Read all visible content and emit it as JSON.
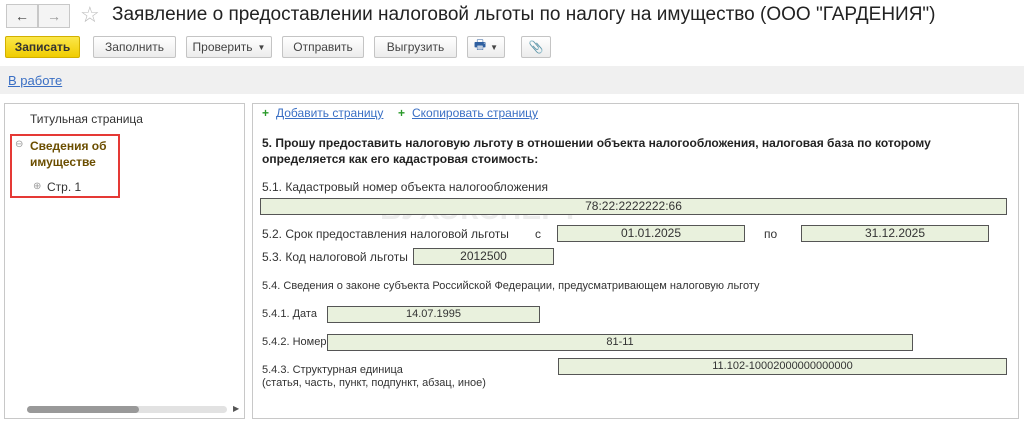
{
  "window": {
    "title": "Заявление о предоставлении налоговой льготы по налогу на имущество (ООО \"ГАРДЕНИЯ\")"
  },
  "toolbar": {
    "save": "Записать",
    "fill": "Заполнить",
    "check": "Проверить",
    "send": "Отправить",
    "export": "Выгрузить"
  },
  "status": {
    "link": "В работе"
  },
  "tree": {
    "items": [
      {
        "label": "Титульная страница"
      },
      {
        "label": "Сведения об имуществе"
      },
      {
        "label": "Стр. 1"
      }
    ]
  },
  "actions": {
    "add_page": "Добавить страницу",
    "copy_page": "Скопировать страницу"
  },
  "form": {
    "heading": "5. Прошу предоставить налоговую льготу в отношении объекта налогообложения, налоговая база по которому определяется как его кадастровая стоимость:",
    "cadastral_label": "5.1. Кадастровый номер объекта налогообложения",
    "cadastral_value": "78:22:2222222:66",
    "period_label": "5.2. Срок предоставления налоговой льготы",
    "from_label": "с",
    "from_value": "01.01.2025",
    "to_label": "по",
    "to_value": "31.12.2025",
    "code_label": "5.3. Код налоговой льготы",
    "code_value": "2012500",
    "law_label": "5.4. Сведения о законе субъекта Российской Федерации, предусматривающем налоговую льготу",
    "date_label": "5.4.1. Дата",
    "date_value": "14.07.1995",
    "number_label": "5.4.2. Номер",
    "number_value": "81-11",
    "unit_label": "5.4.3. Структурная единица",
    "unit_hint": "(статья, часть, пункт, подпункт, абзац, иное)",
    "unit_value": "11.102-10002000000000000"
  },
  "watermark": "БУХЭКСПЕРТ"
}
